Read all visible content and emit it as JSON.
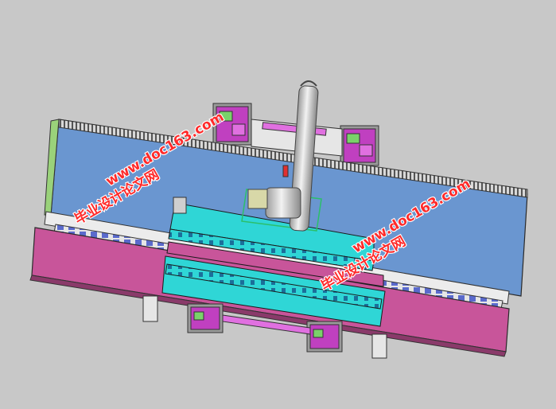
{
  "viewport": {
    "background_color": "#c8c8c8",
    "model_colors": {
      "glass": "#6a96d0",
      "base": "#c8559a",
      "cyan": "#2fd6d6",
      "frame": "#e8e8e8",
      "wheel": "#c040c0",
      "pipe": "#d0d0d0"
    }
  },
  "watermarks": [
    {
      "id": "wm-left",
      "site": "www.doc163.com",
      "label": "毕业设计论文网"
    },
    {
      "id": "wm-right",
      "site": "www.doc163.com",
      "label": "毕业设计论文网"
    }
  ]
}
